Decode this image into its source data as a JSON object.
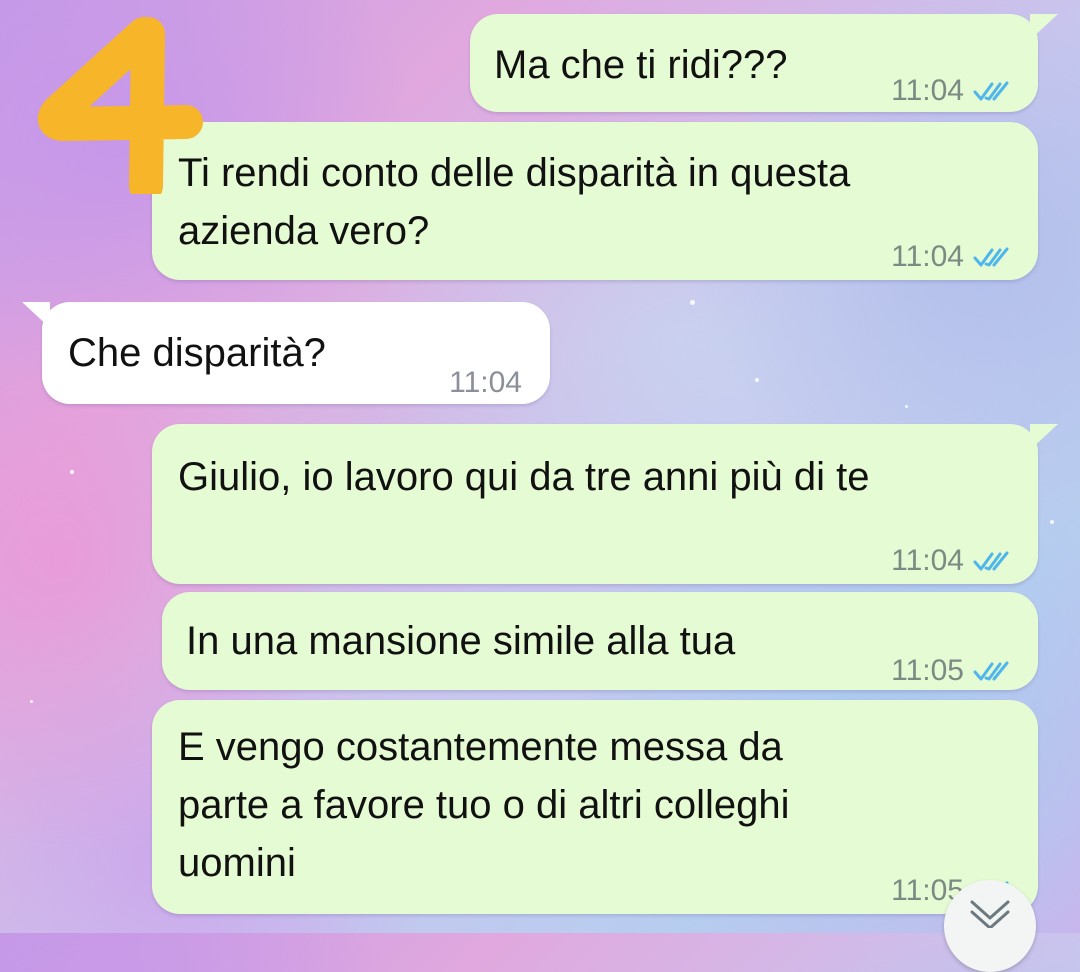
{
  "overlay": {
    "step_number": "4",
    "step_color": "#f7b529"
  },
  "colors": {
    "outgoing_bubble": "#e5fbd3",
    "incoming_bubble": "#ffffff",
    "read_ticks": "#4fb6ec"
  },
  "messages": [
    {
      "direction": "outgoing",
      "text": "Ma che ti ridi???",
      "time": "11:04",
      "status": "read"
    },
    {
      "direction": "outgoing",
      "text": "Ti rendi conto delle disparità in questa\nazienda vero?",
      "time": "11:04",
      "status": "read"
    },
    {
      "direction": "incoming",
      "text": "Che disparità?",
      "time": "11:04"
    },
    {
      "direction": "outgoing",
      "text": "Giulio, io lavoro qui da tre anni più di te",
      "time": "11:04",
      "status": "read"
    },
    {
      "direction": "outgoing",
      "text": "In una mansione simile alla tua",
      "time": "11:05",
      "status": "read"
    },
    {
      "direction": "outgoing",
      "text": "E vengo costantemente messa da\nparte a favore tuo o di altri colleghi\nuomini",
      "time": "11:05",
      "status": "read"
    }
  ],
  "scroll_button": {
    "icon": "chevron-down-icon"
  }
}
